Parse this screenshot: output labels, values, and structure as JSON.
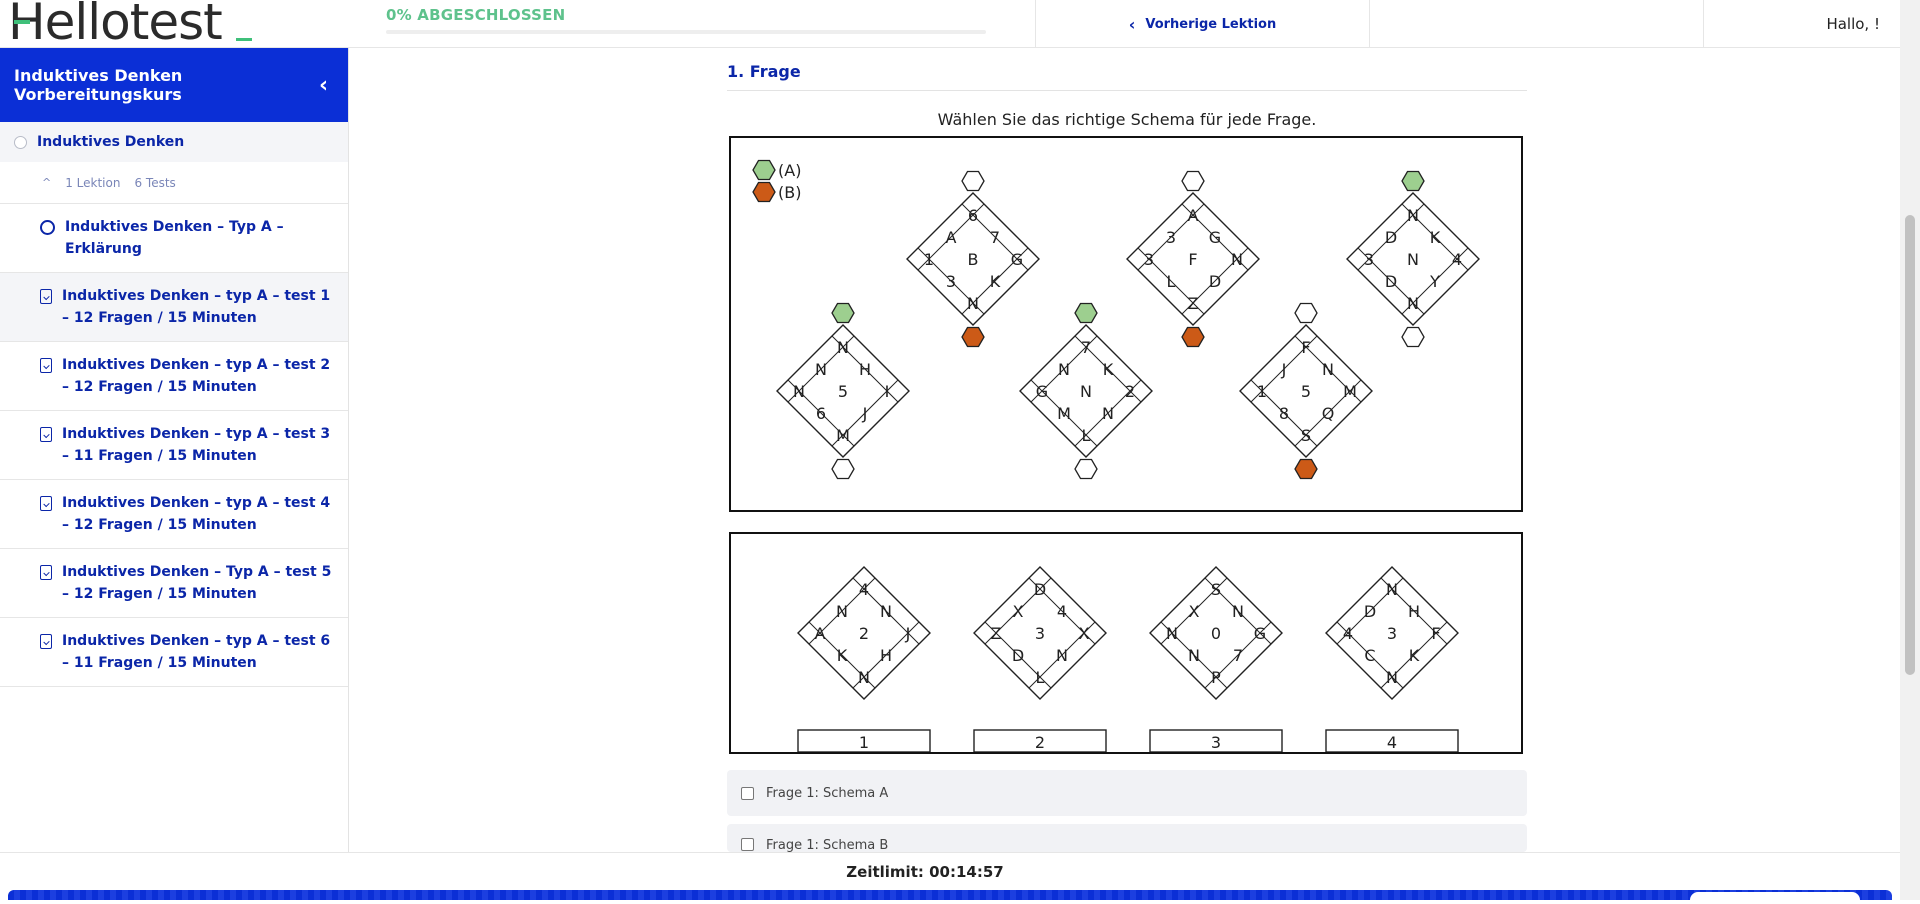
{
  "header": {
    "logo_text": "Hellotest",
    "progress_label": "0% ABGESCHLOSSEN",
    "progress_fraction": 0.0,
    "prev_lesson_label": "Vorherige Lektion",
    "greeting": "Hallo, !"
  },
  "sidebar": {
    "course_title": "Induktives Denken Vorbereitungskurs",
    "section_title": "Induktives Denken",
    "meta_lessons": "1 Lektion",
    "meta_tests": "6 Tests",
    "items": [
      {
        "label": "Induktives Denken – Typ A – Erklärung",
        "icon": "circle-icon"
      },
      {
        "label": "Induktives Denken – typ A – test 1 – 12 Fragen / 15 Minuten",
        "icon": "test-icon"
      },
      {
        "label": "Induktives Denken – typ A – test 2 – 12 Fragen / 15 Minuten",
        "icon": "test-icon"
      },
      {
        "label": "Induktives Denken – typ A – test 3 – 11 Fragen / 15 Minuten",
        "icon": "test-icon"
      },
      {
        "label": "Induktives Denken – typ A – test 4 – 12 Fragen / 15 Minuten",
        "icon": "test-icon"
      },
      {
        "label": "Induktives Denken – Typ A – test 5 – 12 Fragen / 15 Minuten",
        "icon": "test-icon"
      },
      {
        "label": "Induktives Denken – typ A – test 6 – 11 Fragen / 15 Minuten",
        "icon": "test-icon"
      }
    ]
  },
  "main": {
    "question_title": "1. Frage",
    "instruction": "Wählen Sie das richtige Schema für jede Frage.",
    "legend": [
      {
        "label": "(A)",
        "color": "#9dcf8f"
      },
      {
        "label": "(B)",
        "color": "#cc5a17"
      }
    ],
    "colors": {
      "green": "#9dcf8f",
      "orange": "#cc5a17"
    },
    "example_diamonds": [
      {
        "cells": [
          "6",
          "A",
          "7",
          "1",
          "B",
          "G",
          "3",
          "K",
          "N"
        ],
        "top": "white",
        "bottom": "orange"
      },
      {
        "cells": [
          "A",
          "3",
          "G",
          "3",
          "F",
          "N",
          "L",
          "D",
          "Z"
        ],
        "top": "white",
        "bottom": "orange"
      },
      {
        "cells": [
          "N",
          "D",
          "K",
          "3",
          "N",
          "4",
          "D",
          "Y",
          "N"
        ],
        "top": "green",
        "bottom": "white"
      },
      {
        "cells": [
          "N",
          "N",
          "H",
          "N",
          "5",
          "I",
          "6",
          "J",
          "M"
        ],
        "top": "green",
        "bottom": "white"
      },
      {
        "cells": [
          "7",
          "N",
          "K",
          "G",
          "N",
          "2",
          "M",
          "N",
          "L"
        ],
        "top": "green",
        "bottom": "white"
      },
      {
        "cells": [
          "F",
          "J",
          "N",
          "1",
          "5",
          "M",
          "8",
          "Q",
          "S"
        ],
        "top": "white",
        "bottom": "orange"
      }
    ],
    "answer_diamonds": [
      {
        "cells": [
          "4",
          "N",
          "N",
          "A",
          "2",
          "J",
          "K",
          "H",
          "N"
        ],
        "label": "1"
      },
      {
        "cells": [
          "D",
          "X",
          "4",
          "Z",
          "3",
          "X",
          "D",
          "N",
          "L"
        ],
        "label": "2"
      },
      {
        "cells": [
          "S",
          "X",
          "N",
          "N",
          "0",
          "G",
          "N",
          "7",
          "P"
        ],
        "label": "3"
      },
      {
        "cells": [
          "N",
          "D",
          "H",
          "4",
          "3",
          "F",
          "C",
          "K",
          "N"
        ],
        "label": "4"
      }
    ],
    "options": [
      {
        "label": "Frage 1: Schema A",
        "checked": false
      },
      {
        "label": "Frage 1: Schema B",
        "checked": false
      }
    ]
  },
  "footer": {
    "timer": "Zeitlimit: 00:14:57"
  }
}
